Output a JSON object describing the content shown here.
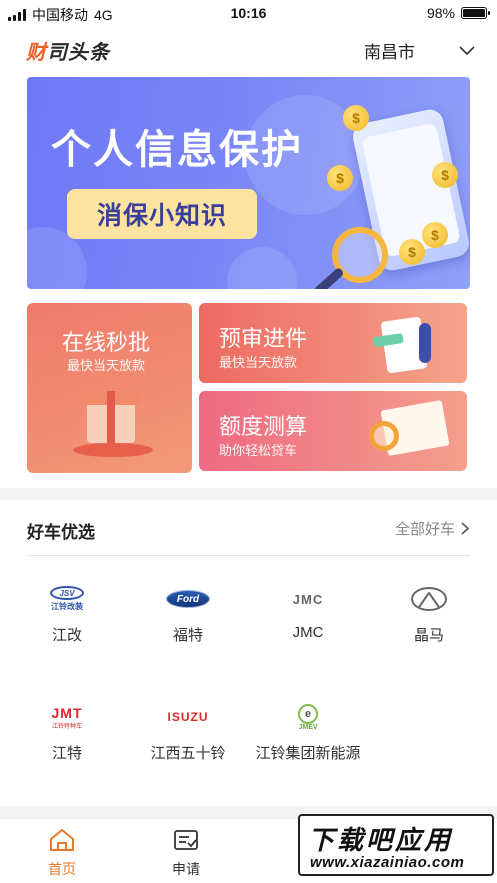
{
  "status_bar": {
    "carrier": "中国移动",
    "network": "4G",
    "time": "10:16",
    "battery": "98%",
    "battery_level": 0.98
  },
  "header": {
    "logo_main": "财",
    "logo_rest": "司头条",
    "city": "南昌市"
  },
  "banner": {
    "title": "个人信息保护",
    "subtitle": "消保小知识"
  },
  "features": [
    {
      "title": "在线秒批",
      "subtitle": "最快当天放款"
    },
    {
      "title": "预审进件",
      "subtitle": "最快当天放款"
    },
    {
      "title": "额度测算",
      "subtitle": "助你轻松贷车"
    }
  ],
  "good_cars": {
    "title": "好车优选",
    "all_link": "全部好车",
    "brands": [
      {
        "name": "江改",
        "logo_text": "JSV",
        "logo_sub": "江铃改装"
      },
      {
        "name": "福特",
        "logo_text": "Ford"
      },
      {
        "name": "JMC",
        "logo_text": "JMC"
      },
      {
        "name": "晶马",
        "logo_text": ""
      },
      {
        "name": "江特",
        "logo_text": "JMT",
        "logo_sub": "江铃特种车"
      },
      {
        "name": "江西五十铃",
        "logo_text": "ISUZU"
      },
      {
        "name": "江铃集团新能源",
        "logo_text": "JMEV",
        "logo_mark": "e"
      }
    ]
  },
  "tabbar": {
    "tabs": [
      {
        "label": "首页",
        "icon": "home-icon",
        "active": true
      },
      {
        "label": "申请",
        "icon": "form-icon",
        "active": false
      }
    ]
  },
  "watermark": {
    "line1": "下载吧应用",
    "line2": "www.xiazainiao.com"
  },
  "colors": {
    "accent": "#e87a2a",
    "banner": "#7a86f7",
    "card_red": "#ee6a63"
  }
}
